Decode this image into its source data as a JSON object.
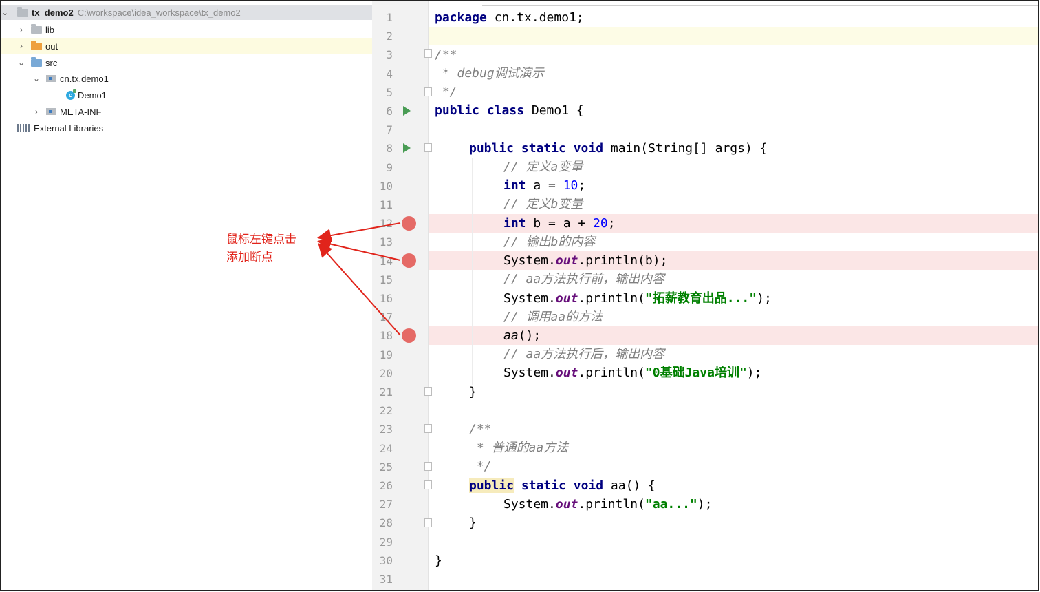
{
  "project_tree": {
    "root": {
      "name": "tx_demo2",
      "path": "C:\\workspace\\idea_workspace\\tx_demo2"
    },
    "items": [
      {
        "label": "lib",
        "icon": "folder-icon"
      },
      {
        "label": "out",
        "icon": "folder-orange-icon"
      },
      {
        "label": "src",
        "icon": "source-folder-icon"
      },
      {
        "label": "cn.tx.demo1",
        "icon": "package-icon"
      },
      {
        "label": "Demo1",
        "icon": "java-class-icon"
      },
      {
        "label": "META-INF",
        "icon": "package-icon"
      },
      {
        "label": "External Libraries",
        "icon": "libraries-icon"
      }
    ]
  },
  "annotation": {
    "line1": "鼠标左键点击",
    "line2": "添加断点",
    "color": "#e1241b"
  },
  "editor": {
    "line_numbers": [
      "1",
      "2",
      "3",
      "4",
      "5",
      "6",
      "7",
      "8",
      "9",
      "10",
      "11",
      "12",
      "13",
      "14",
      "15",
      "16",
      "17",
      "18",
      "19",
      "20",
      "21",
      "22",
      "23",
      "24",
      "25",
      "26",
      "27",
      "28",
      "29",
      "30",
      "31"
    ],
    "breakpoint_lines": [
      12,
      14,
      18
    ],
    "run_lines": [
      6,
      8
    ],
    "code": {
      "l1_kw": "package",
      "l1_rest": " cn.tx.demo1;",
      "l3": "/**",
      "l4": " * debug调试演示",
      "l5": " */",
      "l6_kw": "public class",
      "l6_rest": " Demo1 {",
      "l8_kw": "public static void",
      "l8_rest": " main(String[] args) {",
      "l9": "// 定义a变量",
      "l10_kw": "int",
      "l10_mid": " a = ",
      "l10_num": "10",
      "l10_end": ";",
      "l11": "// 定义b变量",
      "l12_kw": "int",
      "l12_mid": " b = a + ",
      "l12_num": "20",
      "l12_end": ";",
      "l13": "// 输出b的内容",
      "l14_a": "System.",
      "l14_fld": "out",
      "l14_b": ".println(b);",
      "l15": "// aa方法执行前，输出内容",
      "l16_a": "System.",
      "l16_fld": "out",
      "l16_b": ".println(",
      "l16_str": "\"拓薪教育出品...\"",
      "l16_c": ");",
      "l17": "// 调用aa的方法",
      "l18_call": "aa",
      "l18_rest": "();",
      "l19": "// aa方法执行后，输出内容",
      "l20_a": "System.",
      "l20_fld": "out",
      "l20_b": ".println(",
      "l20_str": "\"0基础Java培训\"",
      "l20_c": ");",
      "l21": "}",
      "l23": "/**",
      "l24": " * 普通的aa方法",
      "l25": " */",
      "l26_kw1": "public",
      "l26_kw2": " static void",
      "l26_rest": " aa() {",
      "l27_a": "System.",
      "l27_fld": "out",
      "l27_b": ".println(",
      "l27_str": "\"aa...\"",
      "l27_c": ");",
      "l28": "}",
      "l30": "}"
    }
  }
}
